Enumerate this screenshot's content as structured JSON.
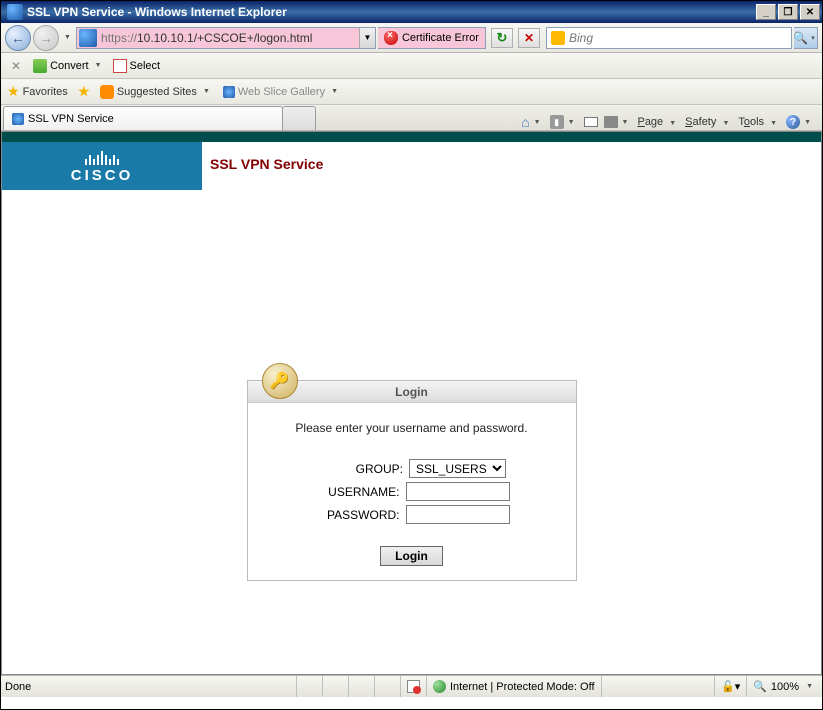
{
  "window": {
    "title": "SSL VPN Service - Windows Internet Explorer"
  },
  "nav": {
    "url_proto": "https://",
    "url_rest": "10.10.10.1/+CSCOE+/logon.html",
    "cert_error": "Certificate Error",
    "search_engine": "Bing"
  },
  "convertbar": {
    "convert": "Convert",
    "select": "Select"
  },
  "favbar": {
    "favorites": "Favorites",
    "suggested": "Suggested Sites",
    "slice": "Web Slice Gallery"
  },
  "tabs": {
    "active": "SSL VPN Service"
  },
  "cmdbar": {
    "page": "Page",
    "safety": "Safety",
    "tools": "Tools"
  },
  "page": {
    "brand": "CISCO",
    "service_title": "SSL VPN Service",
    "login_head": "Login",
    "login_msg": "Please enter your username and password.",
    "group_label": "GROUP:",
    "group_value": "SSL_USERS",
    "user_label": "USERNAME:",
    "pass_label": "PASSWORD:",
    "login_btn": "Login"
  },
  "status": {
    "done": "Done",
    "zone": "Internet | Protected Mode: Off",
    "zoom": "100%"
  }
}
